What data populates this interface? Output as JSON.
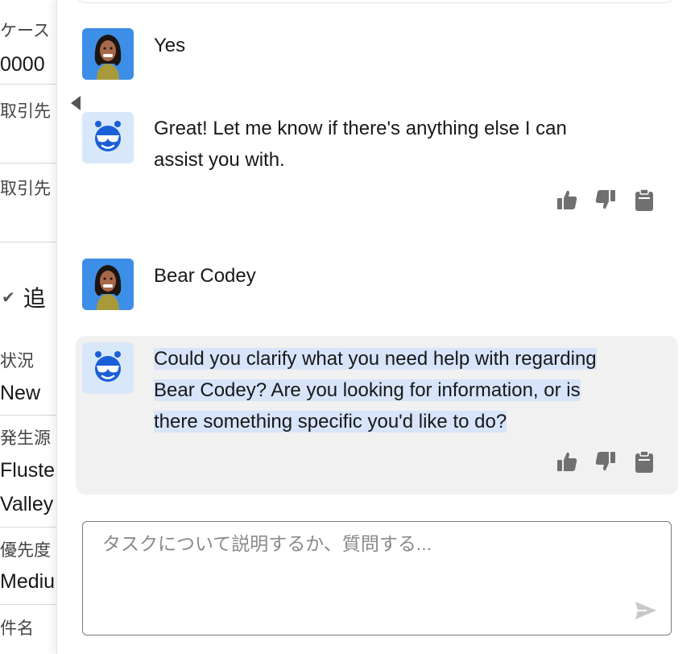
{
  "record_page": {
    "field1_label": "ケース",
    "field1_value": "0000",
    "field2_label": "取引先",
    "field3_label": "取引先",
    "section_title": "追",
    "status_label": "状況",
    "status_value": "New",
    "origin_label": "発生源",
    "origin_value_line1": "Fluste",
    "origin_value_line2": "Valley",
    "priority_label": "優先度",
    "priority_value": "Mediu",
    "subject_label": "件名"
  },
  "chat": {
    "messages": [
      {
        "role": "user",
        "text": "Yes"
      },
      {
        "role": "assistant",
        "text_line1": "Great! Let me know if there's anything else I can",
        "text_line2": "assist you with."
      },
      {
        "role": "user",
        "text": "Bear Codey"
      },
      {
        "role": "assistant",
        "text_line1": "Could you clarify what you need help with regarding",
        "text_line2": "Bear Codey? Are you looking for information, or is",
        "text_line3": "there something specific you'd like to do?"
      }
    ],
    "composer": {
      "placeholder": "タスクについて説明するか、質問する..."
    }
  },
  "icons": {
    "user_avatar": "person-avatar-icon",
    "bot_avatar": "robot-bear-avatar-icon",
    "thumbs_up": "thumbs-up-icon",
    "thumbs_down": "thumbs-down-icon",
    "copy": "clipboard-icon",
    "send": "send-icon",
    "collapse": "caret-left-icon"
  },
  "colors": {
    "user_avatar_bg": "#3d8ee6",
    "bot_avatar_bg": "#d8e8fa",
    "bot_icon": "#1b5fd6",
    "selection_highlight": "#d7e4fa",
    "assistant_bubble": "#f1f1f1"
  }
}
